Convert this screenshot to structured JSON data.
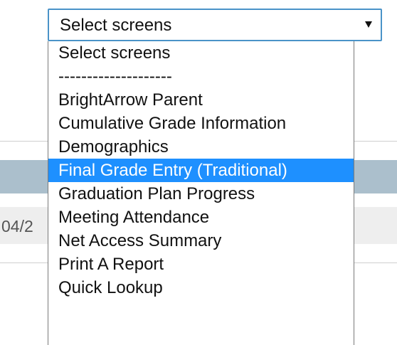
{
  "background": {
    "row_date_fragment": "04/2"
  },
  "select": {
    "current_value": "Select screens",
    "options": [
      {
        "label": "Select screens",
        "selected": false
      },
      {
        "label": "--------------------",
        "selected": false
      },
      {
        "label": "BrightArrow Parent",
        "selected": false
      },
      {
        "label": "Cumulative Grade Information",
        "selected": false
      },
      {
        "label": "Demographics",
        "selected": false
      },
      {
        "label": "Final Grade Entry (Traditional)",
        "selected": true
      },
      {
        "label": "Graduation Plan Progress",
        "selected": false
      },
      {
        "label": "Meeting Attendance",
        "selected": false
      },
      {
        "label": "Net Access Summary",
        "selected": false
      },
      {
        "label": "Print A Report",
        "selected": false
      },
      {
        "label": "Quick Lookup",
        "selected": false
      }
    ]
  },
  "colors": {
    "select_border": "#4a93c8",
    "highlight": "#1e90ff",
    "header_band": "#abbfcc",
    "row_band": "#eeeeee"
  }
}
